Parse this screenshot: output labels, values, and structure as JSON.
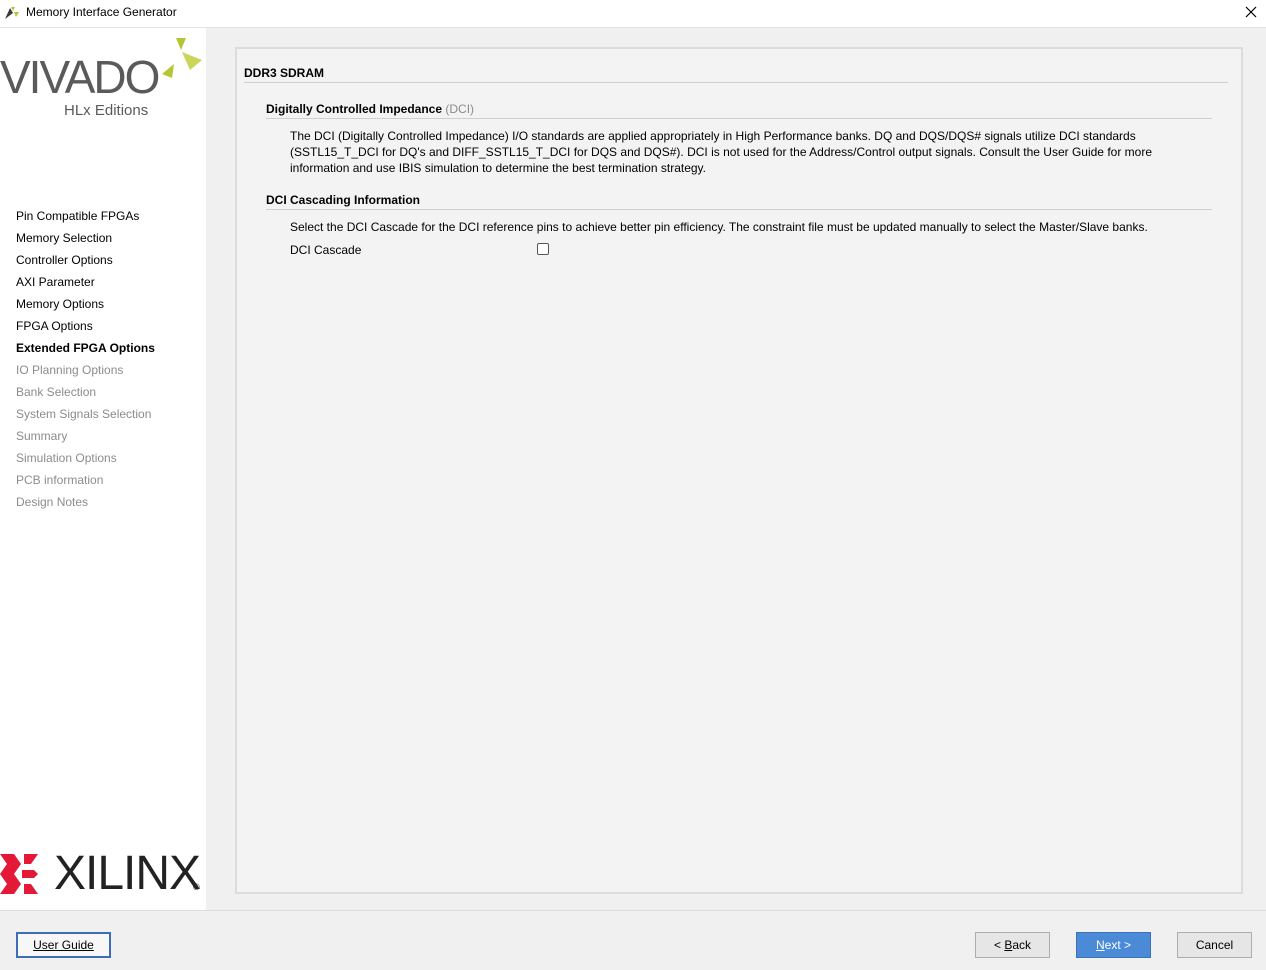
{
  "window": {
    "title": "Memory Interface Generator",
    "close_glyph": "✕"
  },
  "branding": {
    "vivado": "VIVADO",
    "edition": "HLx Editions",
    "xilinx": "XILINX",
    "registered": "®",
    "accent": "#b5c534",
    "xilinx_red": "#e31937"
  },
  "nav": {
    "items": [
      {
        "label": "Pin Compatible FPGAs",
        "state": "done"
      },
      {
        "label": "Memory Selection",
        "state": "done"
      },
      {
        "label": "Controller Options",
        "state": "done"
      },
      {
        "label": "AXI Parameter",
        "state": "done"
      },
      {
        "label": "Memory Options",
        "state": "done"
      },
      {
        "label": "FPGA Options",
        "state": "done"
      },
      {
        "label": "Extended FPGA Options",
        "state": "active"
      },
      {
        "label": "IO Planning Options",
        "state": "disabled"
      },
      {
        "label": "Bank Selection",
        "state": "disabled"
      },
      {
        "label": "System Signals Selection",
        "state": "disabled"
      },
      {
        "label": "Summary",
        "state": "disabled"
      },
      {
        "label": "Simulation Options",
        "state": "disabled"
      },
      {
        "label": "PCB information",
        "state": "disabled"
      },
      {
        "label": "Design Notes",
        "state": "disabled"
      }
    ]
  },
  "main": {
    "title": "DDR3 SDRAM",
    "dci": {
      "heading": "Digitally Controlled Impedance",
      "acronym": "(DCI)",
      "text": "The DCI (Digitally Controlled Impedance) I/O standards are applied appropriately in High Performance banks. DQ and DQS/DQS# signals utilize DCI standards (SSTL15_T_DCI for DQ's and DIFF_SSTL15_T_DCI for DQS and DQS#). DCI is not used for the Address/Control output signals. Consult the User Guide for more information and use IBIS simulation to determine the best termination strategy."
    },
    "cascade": {
      "heading": "DCI Cascading Information",
      "text": "Select the DCI Cascade for the DCI reference pins to achieve better pin efficiency. The constraint file must be updated manually to select the Master/Slave banks.",
      "checkbox_label": "DCI Cascade",
      "checked": false
    }
  },
  "footer": {
    "user_guide": "User Guide",
    "back": {
      "prefix": "< ",
      "mnemonic": "B",
      "rest": "ack"
    },
    "next": {
      "mnemonic": "N",
      "rest": "ext",
      "suffix": " >"
    },
    "cancel": "Cancel"
  }
}
